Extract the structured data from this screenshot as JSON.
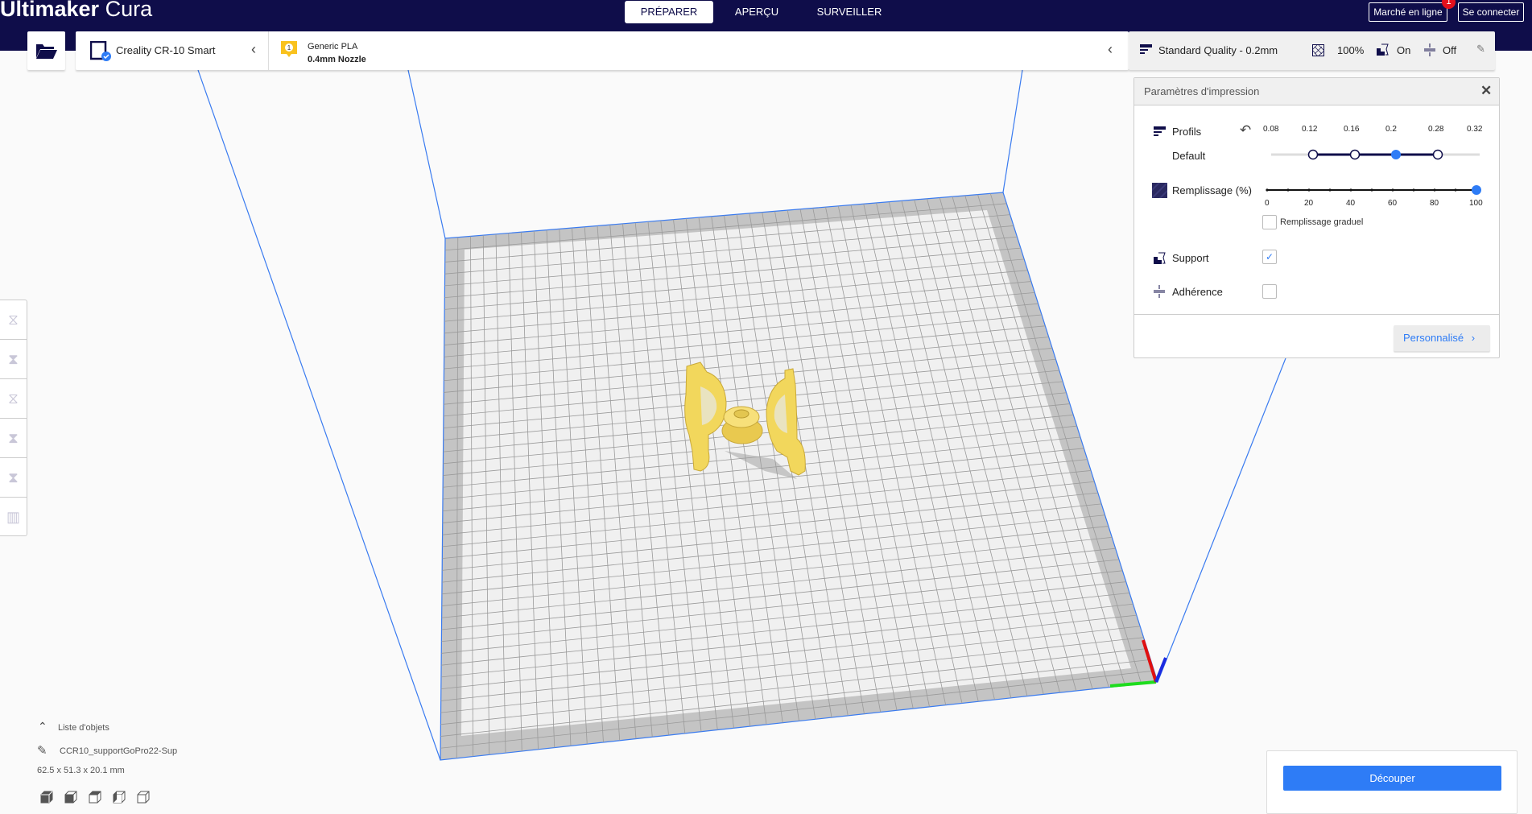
{
  "app": {
    "title_bold": "Ultimaker",
    "title_light": "Cura"
  },
  "tabs": [
    {
      "label": "PRÉPARER",
      "active": true
    },
    {
      "label": "APERÇU"
    },
    {
      "label": "SURVEILLER"
    }
  ],
  "header_buttons": {
    "marketplace": "Marché en ligne",
    "marketplace_badge": "1",
    "login": "Se connecter"
  },
  "printer": {
    "name": "Creality CR-10 Smart"
  },
  "material": {
    "extruder": "1",
    "name": "Generic PLA",
    "nozzle": "0.4mm Nozzle"
  },
  "quality_bar": {
    "profile": "Standard Quality - 0.2mm",
    "infill": "100%",
    "support": "On",
    "adhesion": "Off"
  },
  "print_settings": {
    "title": "Paramètres d'impression",
    "profiles_label": "Profils",
    "profile_value": "Default",
    "layer_heights": [
      "0.08",
      "0.12",
      "0.16",
      "0.2",
      "0.28",
      "0.32"
    ],
    "selected_layer_height": "0.2",
    "infill_label": "Remplissage (%)",
    "infill_ticks": [
      "0",
      "20",
      "40",
      "60",
      "80",
      "100"
    ],
    "infill_value": 100,
    "gradual_label": "Remplissage graduel",
    "gradual_checked": false,
    "support_label": "Support",
    "support_checked": true,
    "adhesion_label": "Adhérence",
    "adhesion_checked": false,
    "custom_button": "Personnalisé"
  },
  "object_list": {
    "header": "Liste d'objets",
    "object_name": "CCR10_supportGoPro22-Sup",
    "dimensions": "62.5 x 51.3 x 20.1 mm"
  },
  "slice_button": "Découper",
  "colors": {
    "brand": "#0f0d4a",
    "accent": "#2e7cf6",
    "model": "#f5d75a"
  }
}
